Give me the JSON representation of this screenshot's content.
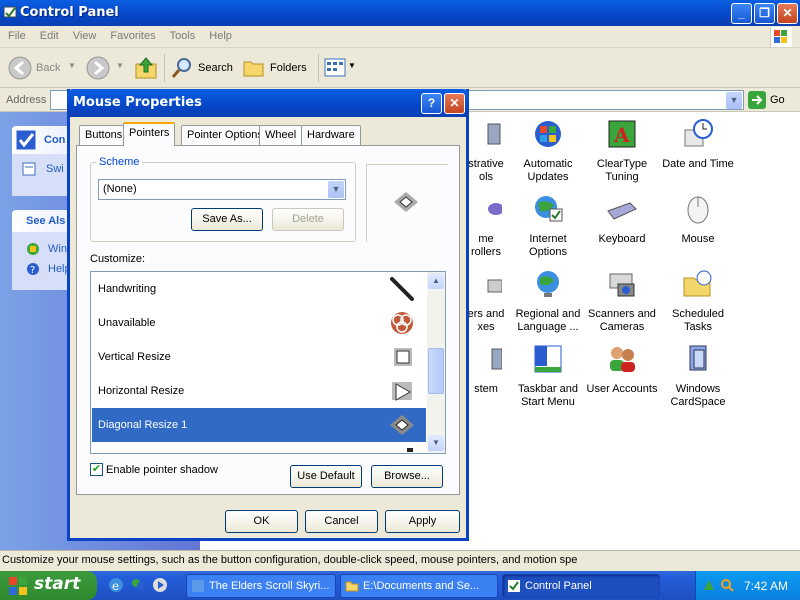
{
  "window": {
    "title": "Control Panel"
  },
  "menu": [
    "File",
    "Edit",
    "View",
    "Favorites",
    "Tools",
    "Help"
  ],
  "toolbar": {
    "back": "Back",
    "search": "Search",
    "folders": "Folders"
  },
  "address": {
    "label": "Address",
    "go": "Go"
  },
  "leftpane": {
    "box1_title": "Con",
    "box1_item": "Swi",
    "box2_title": "See Als",
    "box2_items": [
      "Win",
      "Help"
    ]
  },
  "icons": [
    {
      "label": "strative\nols"
    },
    {
      "label": "Automatic\nUpdates"
    },
    {
      "label": "ClearType\nTuning"
    },
    {
      "label": "Date and Time"
    },
    {
      "label": "me\nrollers"
    },
    {
      "label": "Internet\nOptions"
    },
    {
      "label": "Keyboard"
    },
    {
      "label": "Mouse"
    },
    {
      "label": "ers and\nxes"
    },
    {
      "label": "Regional and\nLanguage ..."
    },
    {
      "label": "Scanners and\nCameras"
    },
    {
      "label": "Scheduled\nTasks"
    },
    {
      "label": "stem"
    },
    {
      "label": "Taskbar and\nStart Menu"
    },
    {
      "label": "User Accounts"
    },
    {
      "label": "Windows\nCardSpace"
    }
  ],
  "dialog": {
    "title": "Mouse Properties",
    "tabs": [
      "Buttons",
      "Pointers",
      "Pointer Options",
      "Wheel",
      "Hardware"
    ],
    "scheme_label": "Scheme",
    "scheme_value": "(None)",
    "save_as": "Save As...",
    "delete": "Delete",
    "customize_label": "Customize:",
    "pointers": [
      "Handwriting",
      "Unavailable",
      "Vertical Resize",
      "Horizontal Resize",
      "Diagonal Resize 1"
    ],
    "selected_pointer": "Diagonal Resize 1",
    "shadow_label": "Enable pointer shadow",
    "shadow_checked": true,
    "use_default": "Use Default",
    "browse": "Browse...",
    "ok": "OK",
    "cancel": "Cancel",
    "apply": "Apply"
  },
  "statusbar": {
    "text": "Customize your mouse settings, such as the button configuration, double-click speed, mouse pointers, and motion spe"
  },
  "taskbar": {
    "start": "start",
    "tasks": [
      "The Elders Scroll Skyri...",
      "E:\\Documents and Se...",
      "Control Panel"
    ],
    "clock": "7:42 AM"
  },
  "colors": {
    "accent": "#0a5fe0",
    "selection": "#316ac5",
    "start": "#3c9b3c"
  }
}
